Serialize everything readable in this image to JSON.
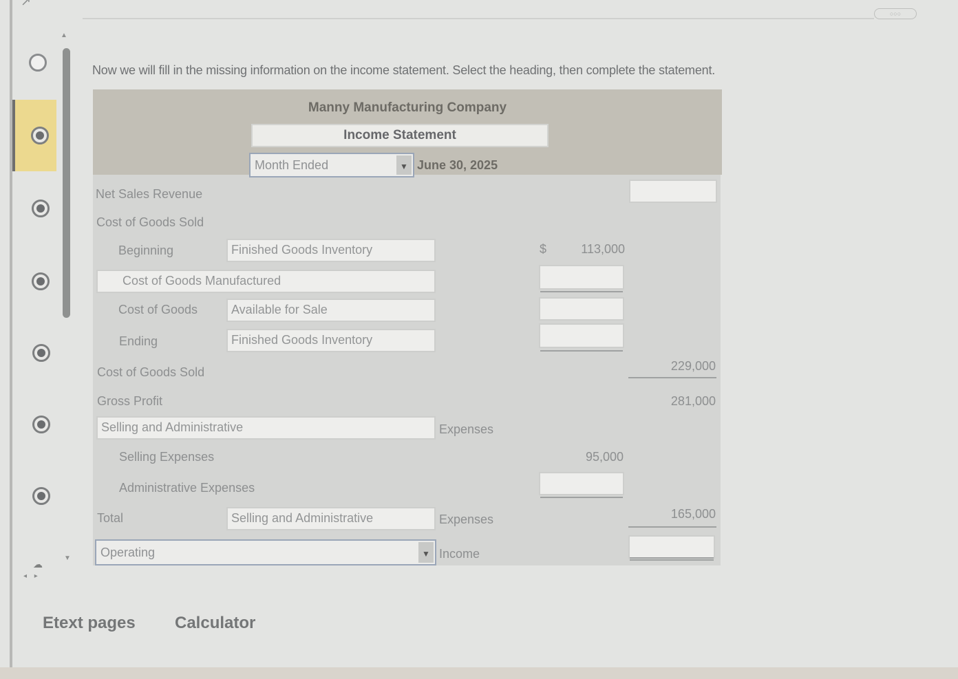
{
  "instruction": "Now we will fill in the missing information on the income statement. Select the heading, then complete the statement.",
  "statement": {
    "company": "Manny Manufacturing Company",
    "title": "Income Statement",
    "period_select": "Month Ended",
    "date": "June 30, 2025"
  },
  "rows": {
    "net_sales_label": "Net Sales Revenue",
    "net_sales_value": "",
    "cogs_header": "Cost of Goods Sold",
    "beginning_label": "Beginning",
    "beginning_field": "Finished Goods Inventory",
    "dollar_sign": "$",
    "beginning_value": "113,000",
    "cogm_field": "Cost of Goods Manufactured",
    "cogm_value": "",
    "cogafs_label": "Cost of Goods",
    "cogafs_field": "Available for Sale",
    "cogafs_value": "",
    "ending_label": "Ending",
    "ending_field": "Finished Goods Inventory",
    "ending_value": "",
    "cogs_total_label": "Cost of Goods Sold",
    "cogs_total_value": "229,000",
    "gross_profit_label": "Gross Profit",
    "gross_profit_value": "281,000",
    "sga_field": "Selling and Administrative",
    "sga_suffix": "Expenses",
    "selling_label": "Selling Expenses",
    "selling_value": "95,000",
    "admin_label": "Administrative Expenses",
    "admin_value": "",
    "total_label": "Total",
    "total_field": "Selling and Administrative",
    "total_suffix": "Expenses",
    "total_value": "165,000",
    "operating_select": "Operating",
    "operating_suffix": "Income",
    "operating_value": ""
  },
  "footer": {
    "etext": "Etext pages",
    "calculator": "Calculator"
  },
  "accent": "#ecd98f"
}
